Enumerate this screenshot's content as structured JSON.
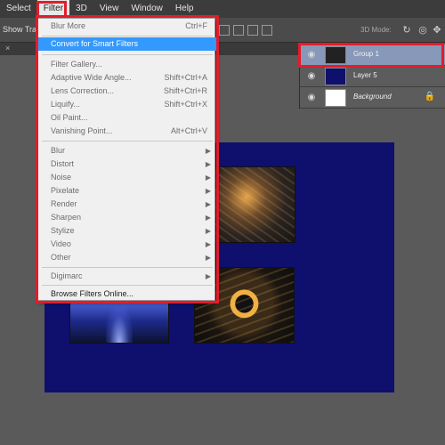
{
  "menubar": {
    "items": [
      "Select",
      "Filter",
      "3D",
      "View",
      "Window",
      "Help"
    ],
    "active": "Filter"
  },
  "options": {
    "show_transform": "Show Trans",
    "mode_3d": "3D Mode:"
  },
  "filter_menu": {
    "items": [
      {
        "label": "Blur More",
        "shortcut": "Ctrl+F"
      },
      {
        "label": "Convert for Smart Filters",
        "shortcut": ""
      },
      {
        "label": "Filter Gallery...",
        "shortcut": ""
      },
      {
        "label": "Adaptive Wide Angle...",
        "shortcut": "Shift+Ctrl+A"
      },
      {
        "label": "Lens Correction...",
        "shortcut": "Shift+Ctrl+R"
      },
      {
        "label": "Liquify...",
        "shortcut": "Shift+Ctrl+X"
      },
      {
        "label": "Oil Paint...",
        "shortcut": ""
      },
      {
        "label": "Vanishing Point...",
        "shortcut": "Alt+Ctrl+V"
      },
      {
        "label": "Blur",
        "submenu": true
      },
      {
        "label": "Distort",
        "submenu": true
      },
      {
        "label": "Noise",
        "submenu": true
      },
      {
        "label": "Pixelate",
        "submenu": true
      },
      {
        "label": "Render",
        "submenu": true
      },
      {
        "label": "Sharpen",
        "submenu": true
      },
      {
        "label": "Stylize",
        "submenu": true
      },
      {
        "label": "Video",
        "submenu": true
      },
      {
        "label": "Other",
        "submenu": true
      },
      {
        "label": "Digimarc",
        "submenu": true
      },
      {
        "label": "Browse Filters Online..."
      }
    ]
  },
  "layers": [
    {
      "name": "Group 1",
      "selected": true
    },
    {
      "name": "Layer 5",
      "selected": false
    },
    {
      "name": "Background",
      "selected": false,
      "locked": true
    }
  ],
  "colors": {
    "highlight_red": "#e21d2b",
    "menu_selection": "#3399ff",
    "canvas_bg": "#0f0f6e"
  }
}
